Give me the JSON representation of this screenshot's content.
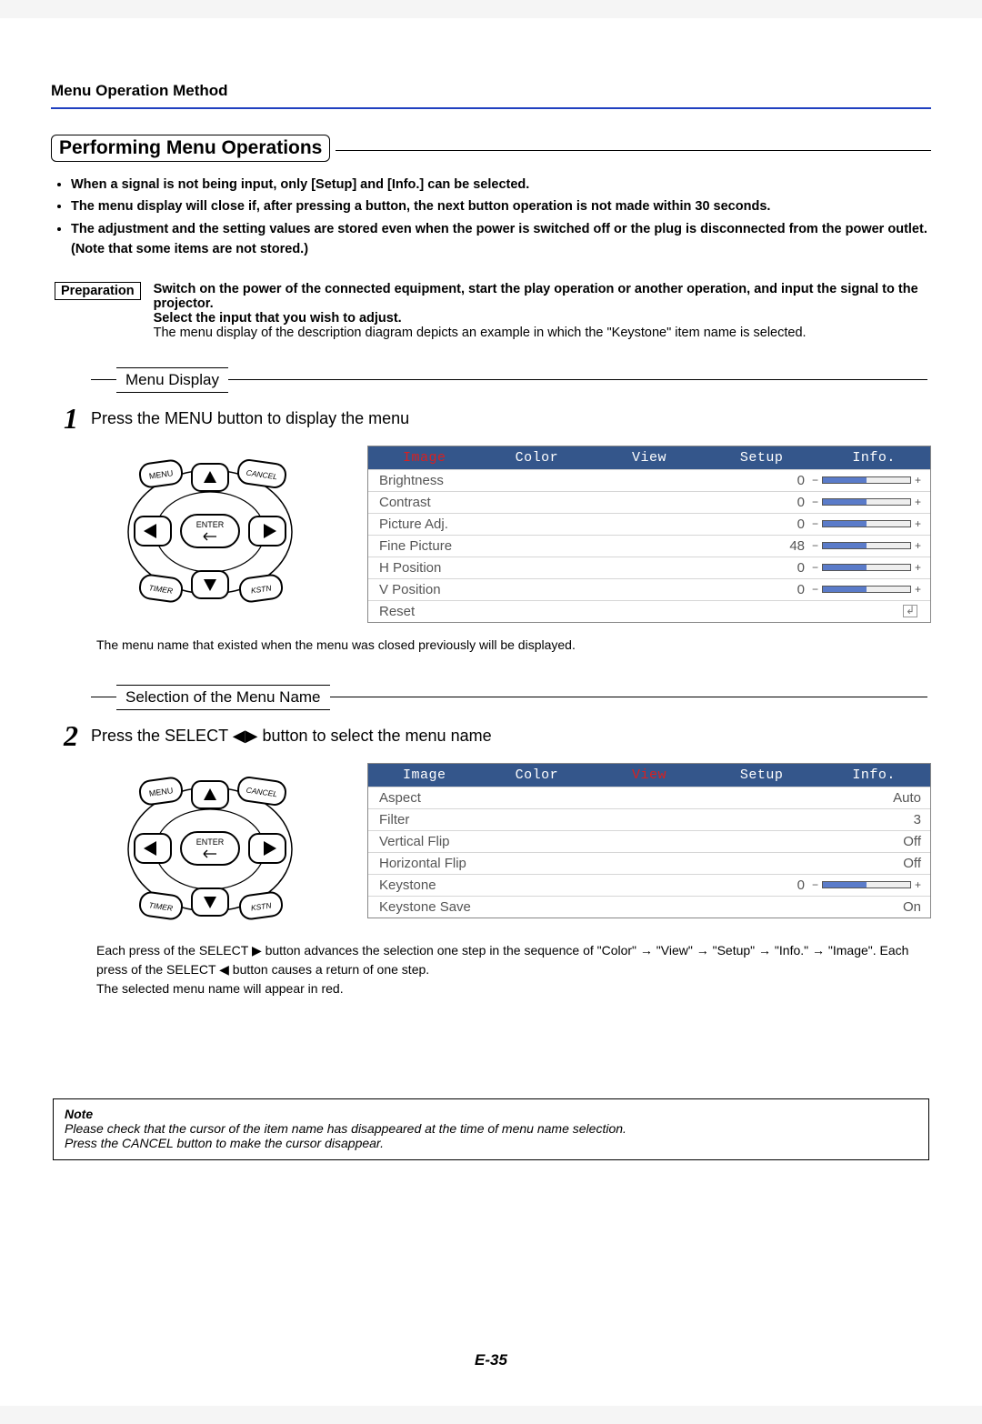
{
  "header": "Menu Operation Method",
  "section_title": "Performing Menu Operations",
  "bullets": [
    "When a signal is not being input, only [Setup] and [Info.] can be selected.",
    "The menu display will close if, after pressing a button, the next button operation is not made within 30 seconds.",
    "The adjustment and the setting values are stored even when the power is switched off or the plug is disconnected from the power outlet.",
    "(Note that some items are not stored.)"
  ],
  "preparation": {
    "label": "Preparation",
    "bold1": "Switch on the power of the connected equipment, start the play operation or another operation, and input the signal to the projector.",
    "bold2": "Select the input that you wish to adjust.",
    "plain": "The menu display of the description diagram depicts an example in which the \"Keystone\" item name is selected."
  },
  "step1": {
    "sub": "Menu Display",
    "num": "1",
    "text": "Press the MENU button to display the menu",
    "osd": {
      "tabs": [
        "Image",
        "Color",
        "View",
        "Setup",
        "Info."
      ],
      "active": 0,
      "rows": [
        {
          "label": "Brightness",
          "value": "0",
          "type": "bar"
        },
        {
          "label": "Contrast",
          "value": "0",
          "type": "bar"
        },
        {
          "label": "Picture Adj.",
          "value": "0",
          "type": "bar"
        },
        {
          "label": "Fine Picture",
          "value": "48",
          "type": "bar"
        },
        {
          "label": "H Position",
          "value": "0",
          "type": "bar"
        },
        {
          "label": "V Position",
          "value": "0",
          "type": "bar"
        },
        {
          "label": "Reset",
          "value": "",
          "type": "reset"
        }
      ]
    },
    "caption": "The menu name that existed when the menu was closed previously will be displayed."
  },
  "step2": {
    "sub": "Selection of the Menu Name",
    "num": "2",
    "text_pre": "Press the SELECT ",
    "text_post": " button to select the menu name",
    "osd": {
      "tabs": [
        "Image",
        "Color",
        "View",
        "Setup",
        "Info."
      ],
      "active": 2,
      "rows": [
        {
          "label": "Aspect",
          "right": "Auto",
          "type": "text"
        },
        {
          "label": "Filter",
          "right": "3",
          "type": "text"
        },
        {
          "label": "Vertical Flip",
          "right": "Off",
          "type": "text"
        },
        {
          "label": "Horizontal Flip",
          "right": "Off",
          "type": "text"
        },
        {
          "label": "Keystone",
          "value": "0",
          "type": "bar"
        },
        {
          "label": "Keystone Save",
          "right": "On",
          "type": "text"
        }
      ]
    },
    "caption_lines": [
      "Each press of the SELECT ▶ button advances the selection one step in the sequence of \"Color\" → \"View\" → \"Setup\" → \"Info.\" → \"Image\". Each press of the SELECT ◀ button causes a return of one step.",
      "The selected menu name will appear in red."
    ]
  },
  "remote": {
    "buttons": [
      "MENU",
      "CANCEL",
      "TIMER",
      "KSTN",
      "ENTER"
    ]
  },
  "note": {
    "title": "Note",
    "line1": "Please check that the cursor of the item name has disappeared at the time of menu name selection.",
    "line2": "Press the CANCEL button to make the cursor disappear."
  },
  "page_number": "E-35"
}
